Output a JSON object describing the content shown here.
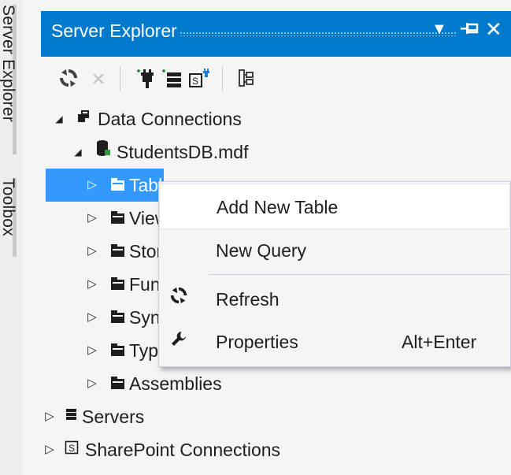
{
  "side_tabs": [
    "Server Explorer",
    "Toolbox"
  ],
  "panel": {
    "title": "Server Explorer",
    "dropdown_glyph": "▼",
    "pin_glyph": "⊣",
    "close_glyph": "✕"
  },
  "toolbar": {
    "icons": [
      "refresh-icon",
      "delete-icon",
      "connect-database-icon",
      "connect-server-icon",
      "connect-sharepoint-icon",
      "properties-icon"
    ]
  },
  "tree": [
    {
      "label": "Data Connections",
      "expander": "◢",
      "icon": "data-connections-icon"
    },
    {
      "label": "StudentsDB.mdf",
      "expander": "◢",
      "icon": "database-icon"
    },
    {
      "label": "Tables",
      "expander": "▷",
      "icon": "folder-icon",
      "selected": true
    },
    {
      "label": "Views",
      "expander": "▷",
      "icon": "folder-icon"
    },
    {
      "label": "Stored Procedures",
      "expander": "▷",
      "icon": "folder-icon"
    },
    {
      "label": "Functions",
      "expander": "▷",
      "icon": "folder-icon"
    },
    {
      "label": "Synonyms",
      "expander": "▷",
      "icon": "folder-icon"
    },
    {
      "label": "Types",
      "expander": "▷",
      "icon": "folder-icon"
    },
    {
      "label": "Assemblies",
      "expander": "▷",
      "icon": "folder-icon"
    },
    {
      "label": "Servers",
      "expander": "▷",
      "icon": "servers-icon"
    },
    {
      "label": "SharePoint Connections",
      "expander": "▷",
      "icon": "sharepoint-icon"
    }
  ],
  "context_menu": {
    "items": [
      {
        "label": "Add New Table",
        "shortcut": "",
        "icon": ""
      },
      {
        "label": "New Query",
        "shortcut": "",
        "icon": ""
      },
      {
        "label": "Refresh",
        "shortcut": "",
        "icon": "refresh-icon"
      },
      {
        "label": "Properties",
        "shortcut": "Alt+Enter",
        "icon": "wrench-icon"
      }
    ]
  },
  "colors": {
    "accent": "#007acc",
    "selection": "#3399ff",
    "background": "#f5f5f5"
  }
}
